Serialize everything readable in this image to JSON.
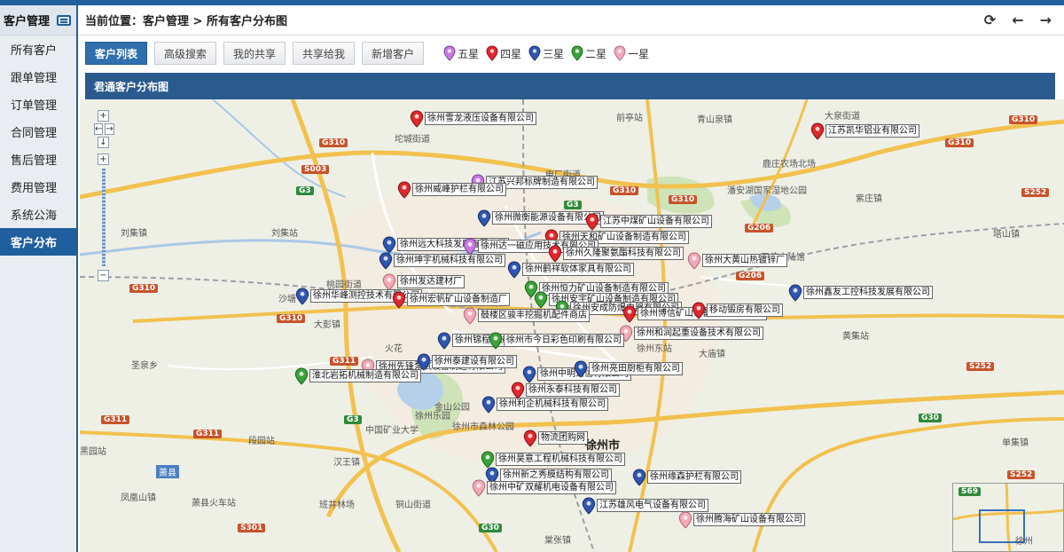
{
  "sidebar": {
    "title": "客户管理",
    "items": [
      {
        "label": "所有客户",
        "active": false
      },
      {
        "label": "跟单管理",
        "active": false
      },
      {
        "label": "订单管理",
        "active": false
      },
      {
        "label": "合同管理",
        "active": false
      },
      {
        "label": "售后管理",
        "active": false
      },
      {
        "label": "费用管理",
        "active": false
      },
      {
        "label": "系统公海",
        "active": false
      },
      {
        "label": "客户分布",
        "active": true
      }
    ]
  },
  "header": {
    "breadcrumb": "当前位置：客户管理 > 所有客户分布图",
    "icons": [
      "refresh-icon",
      "back-arrow-icon",
      "forward-arrow-icon"
    ]
  },
  "toolbar": {
    "buttons": [
      "客户列表",
      "高级搜索",
      "我的共享",
      "共享给我",
      "新增客户"
    ],
    "legend": [
      {
        "label": "五星",
        "color": "#c77be0"
      },
      {
        "label": "四星",
        "color": "#e0282e"
      },
      {
        "label": "三星",
        "color": "#2f56b0"
      },
      {
        "label": "二星",
        "color": "#3aa33a"
      },
      {
        "label": "一星",
        "color": "#f4a9b8"
      }
    ]
  },
  "panel": {
    "title": "君通客户分布图"
  },
  "map": {
    "places": [
      "前亭站",
      "青山泉镇",
      "大泉街道",
      "坨城街道",
      "电厂街道",
      "鹿庄农场北场",
      "潘安湖国家湿地公园",
      "紫庄镇",
      "刘集镇",
      "刘集站",
      "塔山镇",
      "王佳水陆馆",
      "桃园街道",
      "沙塘",
      "大彭镇",
      "火花",
      "徐州东站",
      "大庙镇",
      "黄集站",
      "圣泉乡",
      "金山公园",
      "徐州乐园",
      "徐州市森林公园",
      "中国矿业大学",
      "段园站",
      "汉王镇",
      "萧县",
      "单集镇",
      "黑园站",
      "凤凰山镇",
      "萧县火车站",
      "班井林场",
      "铜山街道",
      "棠张镇",
      "徐州",
      "徐州市"
    ],
    "roads": [
      "G3",
      "G310",
      "S003",
      "G104",
      "G206",
      "S252",
      "G311",
      "G30",
      "S301",
      "S69"
    ],
    "customers": [
      {
        "name": "徐州雪龙液压设备有限公司",
        "star": 4
      },
      {
        "name": "江苏凯华铝业有限公司",
        "star": 4
      },
      {
        "name": "江苏兴邦标牌制造有限公司",
        "star": 5
      },
      {
        "name": "徐州威峰护栏有限公司",
        "star": 4
      },
      {
        "name": "徐州微衡能源设备有限公司",
        "star": 3
      },
      {
        "name": "江苏中煤矿山设备有限公司",
        "star": 4
      },
      {
        "name": "徐州天和矿山设备制造有限公司",
        "star": 4
      },
      {
        "name": "徐州远大科技发展有限公司",
        "star": 3
      },
      {
        "name": "徐州达一磁应用技术有限公司",
        "star": 5
      },
      {
        "name": "徐州久隆聚氨酯科技有限公司",
        "star": 4
      },
      {
        "name": "徐州大黄山热镀锌厂",
        "star": 1
      },
      {
        "name": "徐州坤宇机械科技有限公司",
        "star": 3
      },
      {
        "name": "徐州鹤祥软体家具有限公司",
        "star": 3
      },
      {
        "name": "徐州发达建材厂",
        "star": 1
      },
      {
        "name": "徐州恒力矿山设备制造有限公司",
        "star": 2
      },
      {
        "name": "徐州安宇矿山设备制造有限公司",
        "star": 2
      },
      {
        "name": "徐州安成防爆电器有限公司",
        "star": 2
      },
      {
        "name": "徐州鑫友工控科技发展有限公司",
        "star": 3
      },
      {
        "name": "徐州华峰测控技术有限公司",
        "star": 3
      },
      {
        "name": "徐州宏帆矿山设备制造厂",
        "star": 4
      },
      {
        "name": "徐州博信矿山设备制造有限公司",
        "star": 4
      },
      {
        "name": "鼓楼区骏丰挖掘机配件商店",
        "star": 1
      },
      {
        "name": "移动锻房有限公司",
        "star": 4
      },
      {
        "name": "徐州和润起重设备技术有限公司",
        "star": 1
      },
      {
        "name": "徐州锦程机械有限公司",
        "star": 3
      },
      {
        "name": "徐州市今日彩色印刷有限公司",
        "star": 2
      },
      {
        "name": "徐州先锋泵氧设备制造有限公司",
        "star": 1
      },
      {
        "name": "徐州泰建设有限公司",
        "star": 3
      },
      {
        "name": "徐州中明通信有限公司",
        "star": 3
      },
      {
        "name": "徐州亮田厨柜有限公司",
        "star": 3
      },
      {
        "name": "淮北岩拓机械制造有限公司",
        "star": 2
      },
      {
        "name": "徐州利企机械科技有限公司",
        "star": 3
      },
      {
        "name": "徐州永泰科技有限公司",
        "star": 4
      },
      {
        "name": "物流团购网",
        "star": 4
      },
      {
        "name": "徐州昊意工程机械科技有限公司",
        "star": 2
      },
      {
        "name": "徐州新之秀膜结构有限公司",
        "star": 3
      },
      {
        "name": "徐州缘森护栏有限公司",
        "star": 3
      },
      {
        "name": "徐州中矿双耀机电设备有限公司",
        "star": 1
      },
      {
        "name": "江苏雄风电气设备有限公司",
        "star": 3
      },
      {
        "name": "徐州腾海矿山设备有限公司",
        "star": 1
      }
    ]
  }
}
